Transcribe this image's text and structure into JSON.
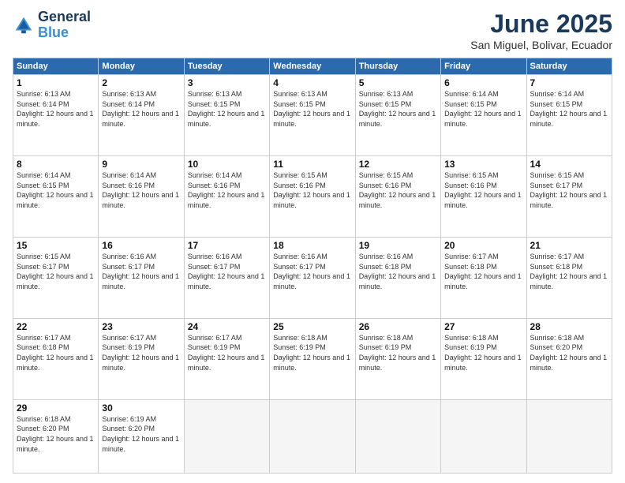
{
  "logo": {
    "line1": "General",
    "line2": "Blue"
  },
  "title": "June 2025",
  "location": "San Miguel, Bolivar, Ecuador",
  "header_days": [
    "Sunday",
    "Monday",
    "Tuesday",
    "Wednesday",
    "Thursday",
    "Friday",
    "Saturday"
  ],
  "weeks": [
    [
      {
        "day": 1,
        "sunrise": "6:13 AM",
        "sunset": "6:14 PM",
        "daylight": "12 hours and 1 minute."
      },
      {
        "day": 2,
        "sunrise": "6:13 AM",
        "sunset": "6:14 PM",
        "daylight": "12 hours and 1 minute."
      },
      {
        "day": 3,
        "sunrise": "6:13 AM",
        "sunset": "6:15 PM",
        "daylight": "12 hours and 1 minute."
      },
      {
        "day": 4,
        "sunrise": "6:13 AM",
        "sunset": "6:15 PM",
        "daylight": "12 hours and 1 minute."
      },
      {
        "day": 5,
        "sunrise": "6:13 AM",
        "sunset": "6:15 PM",
        "daylight": "12 hours and 1 minute."
      },
      {
        "day": 6,
        "sunrise": "6:14 AM",
        "sunset": "6:15 PM",
        "daylight": "12 hours and 1 minute."
      },
      {
        "day": 7,
        "sunrise": "6:14 AM",
        "sunset": "6:15 PM",
        "daylight": "12 hours and 1 minute."
      }
    ],
    [
      {
        "day": 8,
        "sunrise": "6:14 AM",
        "sunset": "6:15 PM",
        "daylight": "12 hours and 1 minute."
      },
      {
        "day": 9,
        "sunrise": "6:14 AM",
        "sunset": "6:16 PM",
        "daylight": "12 hours and 1 minute."
      },
      {
        "day": 10,
        "sunrise": "6:14 AM",
        "sunset": "6:16 PM",
        "daylight": "12 hours and 1 minute."
      },
      {
        "day": 11,
        "sunrise": "6:15 AM",
        "sunset": "6:16 PM",
        "daylight": "12 hours and 1 minute."
      },
      {
        "day": 12,
        "sunrise": "6:15 AM",
        "sunset": "6:16 PM",
        "daylight": "12 hours and 1 minute."
      },
      {
        "day": 13,
        "sunrise": "6:15 AM",
        "sunset": "6:16 PM",
        "daylight": "12 hours and 1 minute."
      },
      {
        "day": 14,
        "sunrise": "6:15 AM",
        "sunset": "6:17 PM",
        "daylight": "12 hours and 1 minute."
      }
    ],
    [
      {
        "day": 15,
        "sunrise": "6:15 AM",
        "sunset": "6:17 PM",
        "daylight": "12 hours and 1 minute."
      },
      {
        "day": 16,
        "sunrise": "6:16 AM",
        "sunset": "6:17 PM",
        "daylight": "12 hours and 1 minute."
      },
      {
        "day": 17,
        "sunrise": "6:16 AM",
        "sunset": "6:17 PM",
        "daylight": "12 hours and 1 minute."
      },
      {
        "day": 18,
        "sunrise": "6:16 AM",
        "sunset": "6:17 PM",
        "daylight": "12 hours and 1 minute."
      },
      {
        "day": 19,
        "sunrise": "6:16 AM",
        "sunset": "6:18 PM",
        "daylight": "12 hours and 1 minute."
      },
      {
        "day": 20,
        "sunrise": "6:17 AM",
        "sunset": "6:18 PM",
        "daylight": "12 hours and 1 minute."
      },
      {
        "day": 21,
        "sunrise": "6:17 AM",
        "sunset": "6:18 PM",
        "daylight": "12 hours and 1 minute."
      }
    ],
    [
      {
        "day": 22,
        "sunrise": "6:17 AM",
        "sunset": "6:18 PM",
        "daylight": "12 hours and 1 minute."
      },
      {
        "day": 23,
        "sunrise": "6:17 AM",
        "sunset": "6:19 PM",
        "daylight": "12 hours and 1 minute."
      },
      {
        "day": 24,
        "sunrise": "6:17 AM",
        "sunset": "6:19 PM",
        "daylight": "12 hours and 1 minute."
      },
      {
        "day": 25,
        "sunrise": "6:18 AM",
        "sunset": "6:19 PM",
        "daylight": "12 hours and 1 minute."
      },
      {
        "day": 26,
        "sunrise": "6:18 AM",
        "sunset": "6:19 PM",
        "daylight": "12 hours and 1 minute."
      },
      {
        "day": 27,
        "sunrise": "6:18 AM",
        "sunset": "6:19 PM",
        "daylight": "12 hours and 1 minute."
      },
      {
        "day": 28,
        "sunrise": "6:18 AM",
        "sunset": "6:20 PM",
        "daylight": "12 hours and 1 minute."
      }
    ],
    [
      {
        "day": 29,
        "sunrise": "6:18 AM",
        "sunset": "6:20 PM",
        "daylight": "12 hours and 1 minute."
      },
      {
        "day": 30,
        "sunrise": "6:19 AM",
        "sunset": "6:20 PM",
        "daylight": "12 hours and 1 minute."
      },
      null,
      null,
      null,
      null,
      null
    ]
  ]
}
